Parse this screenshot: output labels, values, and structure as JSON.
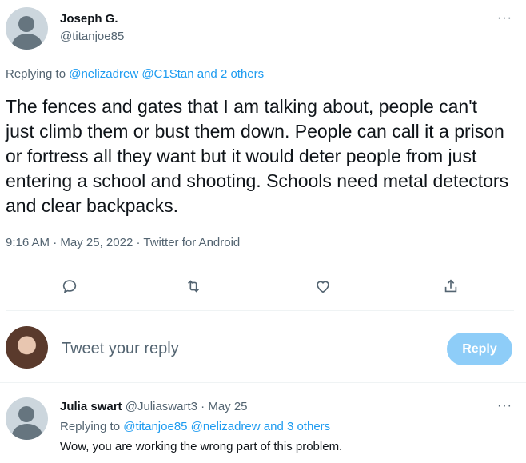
{
  "tweet": {
    "author_name": "Joseph G.",
    "author_handle": "@titanjoe85",
    "replying_prefix": "Replying to",
    "replying_mentions": "@nelizadrew @C1Stan and 2 others",
    "text": "The fences and gates that I am talking about, people can't just climb them or bust them down. People can call it a prison or fortress all they want but it would deter people from just entering a school and shooting. Schools need metal detectors and clear backpacks.",
    "time": "9:16 AM",
    "date": "May 25, 2022",
    "source": "Twitter for Android",
    "separator": "·",
    "more_icon": "···"
  },
  "compose": {
    "placeholder": "Tweet your reply",
    "button_label": "Reply"
  },
  "reply": {
    "author_name": "Julia swart",
    "author_handle": "@Juliaswart3",
    "date": "May 25",
    "replying_prefix": "Replying to",
    "replying_mentions": "@titanjoe85 @nelizadrew and 3 others",
    "text": "Wow, you are working the wrong part of this problem.",
    "more_icon": "···"
  },
  "colors": {
    "accent": "#1d9bf0",
    "reply_button_disabled": "#8ecdf8",
    "muted": "#536471"
  },
  "icons": [
    "comment-icon",
    "retweet-icon",
    "like-icon",
    "share-icon",
    "more-icon"
  ]
}
